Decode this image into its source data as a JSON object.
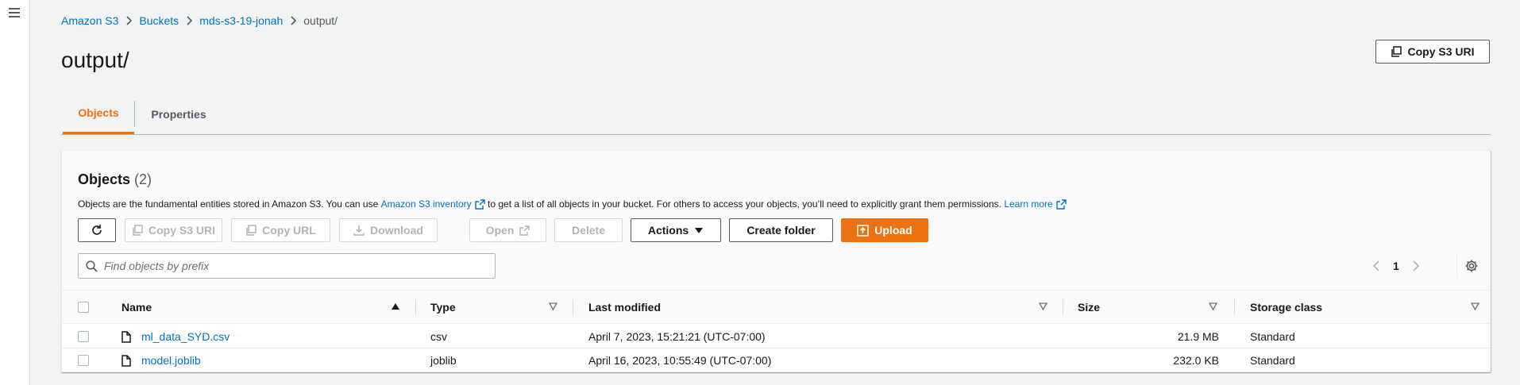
{
  "icons": {
    "menu": "hamburger-menu-icon",
    "breadcrumb_separator": "chevron-right-icon",
    "copy": "copy-icon",
    "external": "external-link-icon",
    "refresh": "refresh-icon",
    "download": "download-icon",
    "upload": "upload-icon",
    "caret": "caret-down-icon",
    "search": "search-icon",
    "settings": "gear-icon",
    "file": "file-icon"
  },
  "colors": {
    "accent": "#ec7211",
    "link": "#0073bb",
    "text": "#16191f",
    "muted": "#545b64",
    "disabled": "#aab7b8"
  },
  "breadcrumb": {
    "items": [
      {
        "label": "Amazon S3"
      },
      {
        "label": "Buckets"
      },
      {
        "label": "mds-s3-19-jonah"
      }
    ],
    "current": "output/"
  },
  "header": {
    "title": "output/",
    "copy_s3_uri_label": "Copy S3 URI"
  },
  "tabs": [
    {
      "label": "Objects",
      "active": true
    },
    {
      "label": "Properties",
      "active": false
    }
  ],
  "objects_panel": {
    "heading": "Objects",
    "count": "(2)",
    "description_prefix": "Objects are the fundamental entities stored in Amazon S3. You can use",
    "inventory_link": "Amazon S3 inventory",
    "description_middle": "to get a list of all objects in your bucket. For others to access your objects, you’ll need to explicitly grant them permissions.",
    "learn_more": "Learn more",
    "toolbar": {
      "copy_s3_uri": "Copy S3 URI",
      "copy_url": "Copy URL",
      "download": "Download",
      "open": "Open",
      "delete": "Delete",
      "actions": "Actions",
      "create_folder": "Create folder",
      "upload": "Upload"
    },
    "search": {
      "placeholder": "Find objects by prefix",
      "value": ""
    },
    "pagination": {
      "current_page": "1"
    }
  },
  "table": {
    "columns": [
      {
        "label": "Name",
        "sort": "ascending"
      },
      {
        "label": "Type",
        "sort": "none"
      },
      {
        "label": "Last modified",
        "sort": "none"
      },
      {
        "label": "Size",
        "sort": "none"
      },
      {
        "label": "Storage class",
        "sort": "none"
      }
    ],
    "rows": [
      {
        "name": "ml_data_SYD.csv",
        "type": "csv",
        "last_modified": "April 7, 2023, 15:21:21 (UTC-07:00)",
        "size": "21.9 MB",
        "storage_class": "Standard"
      },
      {
        "name": "model.joblib",
        "type": "joblib",
        "last_modified": "April 16, 2023, 10:55:49 (UTC-07:00)",
        "size": "232.0 KB",
        "storage_class": "Standard"
      }
    ]
  }
}
